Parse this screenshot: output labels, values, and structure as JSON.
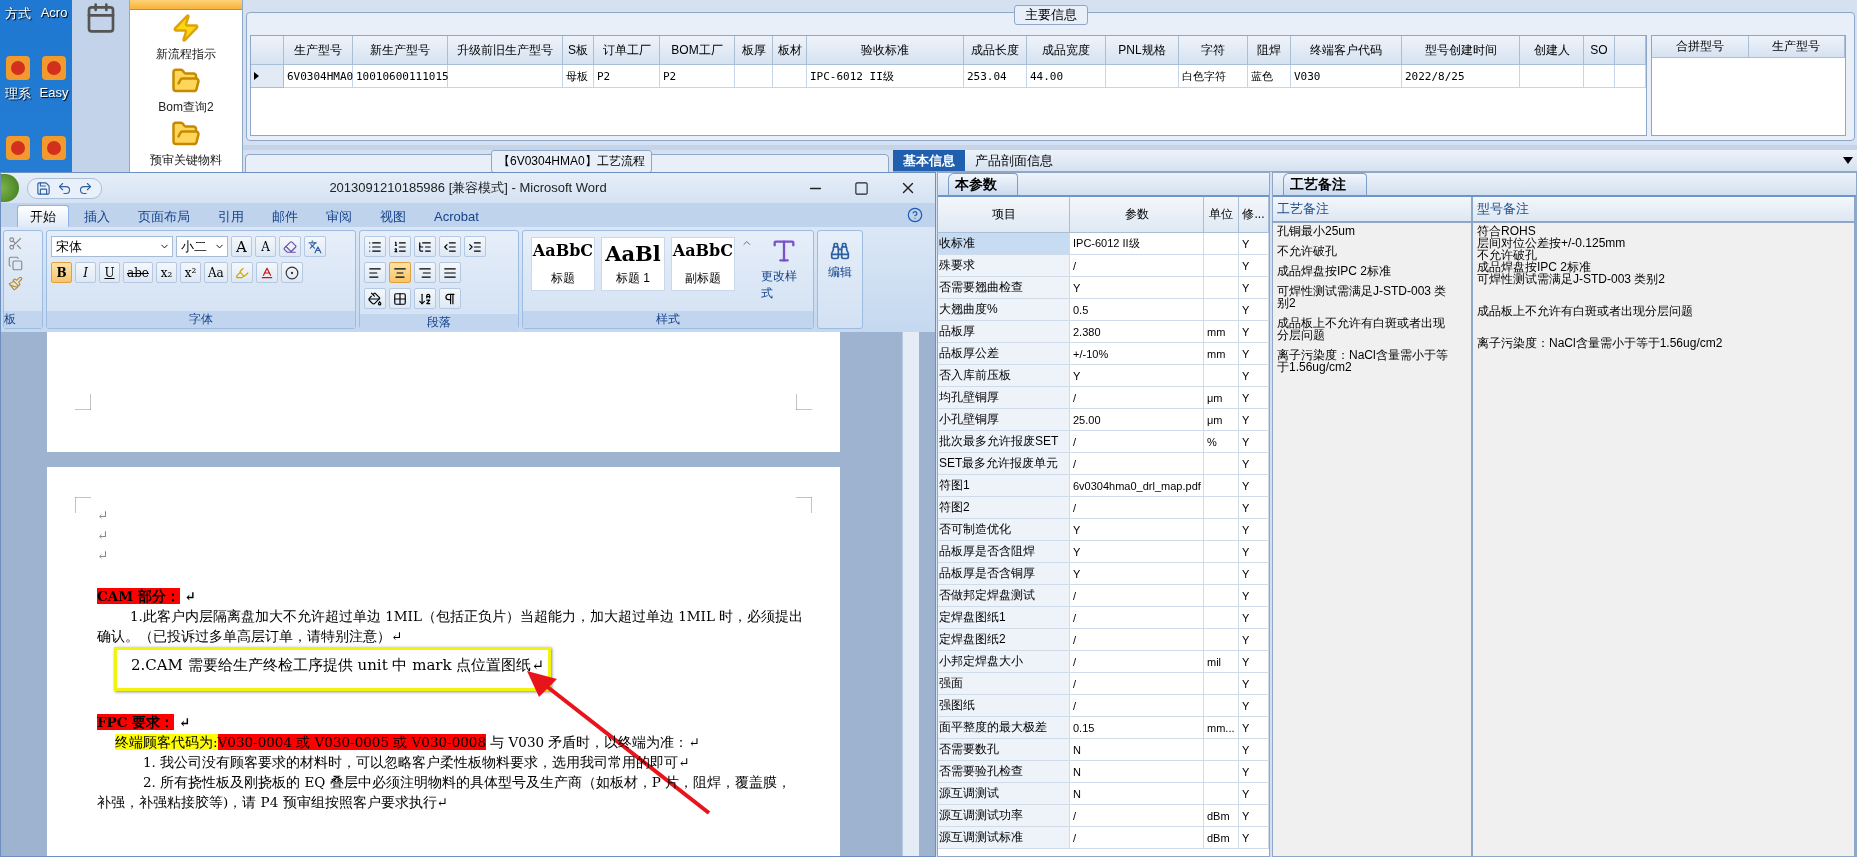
{
  "desktop_icons": [
    {
      "kind": "labeled",
      "label": "方式"
    },
    {
      "kind": "labeled",
      "label": "Acro"
    },
    {
      "kind": "labeled",
      "label": "理系"
    },
    {
      "kind": "labeled",
      "label": "Easy"
    },
    {
      "kind": "unlabeled"
    },
    {
      "kind": "unlabeled"
    }
  ],
  "sidebar": {
    "items": [
      {
        "kind": "process",
        "label": "新流程指示"
      },
      {
        "kind": "folder",
        "label": "Bom查询2"
      },
      {
        "kind": "folder",
        "label": "预审关键物料"
      }
    ]
  },
  "main_info": {
    "title": "主要信息",
    "columns": [
      "生产型号",
      "新生产型号",
      "升级前旧生产型号",
      "S板",
      "订单工厂",
      "BOM工厂",
      "板厚",
      "板材",
      "验收标准",
      "成品长度",
      "成品宽度",
      "PNL规格",
      "字符",
      "阻焊",
      "终端客户代码",
      "型号创建时间",
      "创建人",
      "SO"
    ],
    "rows": [
      {
        "selected": true,
        "cells": [
          "6V0304HMA0",
          "10010600111015",
          null,
          "母板",
          "P2",
          "P2",
          null,
          null,
          "IPC-6012 II级",
          "253.04",
          "44.00",
          null,
          "白色字符",
          "蓝色",
          "V030",
          "2022/8/25",
          null,
          null
        ]
      }
    ],
    "merge_columns": [
      "合拼型号",
      "生产型号"
    ]
  },
  "flow_panel": {
    "title": "【6V0304HMA0】工艺流程"
  },
  "detail_tabs": [
    {
      "label": "基本信息",
      "selected": true
    },
    {
      "label": "产品剖面信息",
      "selected": false
    }
  ],
  "params": {
    "tab": "本参数",
    "columns": [
      "项目",
      "参数",
      "单位",
      "修..."
    ],
    "rows": [
      {
        "item": "收标准",
        "value": "IPC-6012 II级",
        "flag": "Y",
        "selected": true
      },
      {
        "item": "殊要求",
        "value": "/",
        "flag": "Y",
        "selected": false
      },
      {
        "item": "否需要翘曲检查",
        "value": "Y",
        "flag": "Y",
        "selected": false
      },
      {
        "item": "大翘曲度%",
        "value": "0.5",
        "flag": "Y",
        "selected": false
      },
      {
        "item": "品板厚",
        "value": "2.380",
        "unit": "mm",
        "flag": "Y",
        "selected": false
      },
      {
        "item": "品板厚公差",
        "value": "+/-10%",
        "unit": "mm",
        "flag": "Y",
        "selected": false
      },
      {
        "item": "否入库前压板",
        "value": "Y",
        "flag": "Y",
        "selected": false
      },
      {
        "item": "均孔壁铜厚",
        "value": "/",
        "unit": "μm",
        "flag": "Y",
        "selected": false
      },
      {
        "item": "小孔壁铜厚",
        "value": "25.00",
        "unit": "μm",
        "flag": "Y",
        "selected": false
      },
      {
        "item": "批次最多允许报废SET",
        "value": "/",
        "unit": "%",
        "flag": "Y",
        "selected": false
      },
      {
        "item": "SET最多允许报废单元",
        "value": "/",
        "flag": "Y",
        "selected": false
      },
      {
        "item": "符图1",
        "value": "6v0304hma0_drl_map.pdf",
        "flag": "Y",
        "selected": false
      },
      {
        "item": "符图2",
        "value": "/",
        "flag": "Y",
        "selected": false
      },
      {
        "item": "否可制造优化",
        "value": "Y",
        "flag": "Y",
        "selected": false
      },
      {
        "item": "品板厚是否含阻焊",
        "value": "Y",
        "flag": "Y",
        "selected": false
      },
      {
        "item": "品板厚是否含铜厚",
        "value": "Y",
        "flag": "Y",
        "selected": false
      },
      {
        "item": "否做邦定焊盘测试",
        "value": "/",
        "flag": "Y",
        "selected": false
      },
      {
        "item": "定焊盘图纸1",
        "value": "/",
        "flag": "Y",
        "selected": false
      },
      {
        "item": "定焊盘图纸2",
        "value": "/",
        "flag": "Y",
        "selected": false
      },
      {
        "item": "小邦定焊盘大小",
        "value": "/",
        "unit": "mil",
        "flag": "Y",
        "selected": false
      },
      {
        "item": "强面",
        "value": "/",
        "flag": "Y",
        "selected": false
      },
      {
        "item": "强图纸",
        "value": "/",
        "flag": "Y",
        "selected": false
      },
      {
        "item": "面平整度的最大极差",
        "value": "0.15",
        "unit": "mm...",
        "flag": "Y",
        "selected": false
      },
      {
        "item": "否需要数孔",
        "value": "N",
        "flag": "Y",
        "selected": false
      },
      {
        "item": "否需要验孔检查",
        "value": "N",
        "flag": "Y",
        "selected": false
      },
      {
        "item": "源互调测试",
        "value": "N",
        "flag": "Y",
        "selected": false
      },
      {
        "item": "源互调测试功率",
        "value": "/",
        "unit": "dBm",
        "flag": "Y",
        "selected": false
      },
      {
        "item": "源互调测试标准",
        "value": "/",
        "unit": "dBm",
        "flag": "Y",
        "selected": false
      }
    ]
  },
  "notes": {
    "tab": "工艺备注",
    "columns": [
      "工艺备注",
      "型号备注"
    ],
    "process_notes": [
      "孔铜最小25um",
      "不允许破孔",
      "成品焊盘按IPC 2标准",
      "可焊性测试需满足J-STD-003 类别2",
      "成品板上不允许有白斑或者出现分层问题",
      "离子污染度：NaCl含量需小于等于1.56ug/cm2"
    ],
    "model_notes": [
      [
        "符合ROHS",
        "层间对位公差按+/-0.125mm",
        "不允许破孔",
        "成品焊盘按IPC 2标准",
        "可焊性测试需满足J-STD-003 类别2"
      ],
      [
        "成品板上不允许有白斑或者出现分层问题"
      ],
      [
        "离子污染度：NaCl含量需小于等于1.56ug/cm2"
      ]
    ]
  },
  "word": {
    "title": "2013091210185986 [兼容模式] - Microsoft Word",
    "tabs": [
      {
        "label": "开始",
        "selected": true
      },
      {
        "label": "插入",
        "selected": false
      },
      {
        "label": "页面布局",
        "selected": false
      },
      {
        "label": "引用",
        "selected": false
      },
      {
        "label": "邮件",
        "selected": false
      },
      {
        "label": "审阅",
        "selected": false
      },
      {
        "label": "视图",
        "selected": false
      },
      {
        "label": "Acrobat",
        "selected": false
      }
    ],
    "clipboard_group": "板",
    "font": {
      "name": "宋体",
      "size": "小二",
      "size_buttons": [
        "A",
        "A"
      ],
      "format_buttons": [
        {
          "label": "B",
          "selected": true
        },
        {
          "label": "I",
          "selected": false
        },
        {
          "label": "U",
          "selected": false
        },
        {
          "label": "abe",
          "selected": false
        },
        {
          "label": "x₂",
          "selected": false
        },
        {
          "label": "x²",
          "selected": false
        },
        {
          "label": "Aa",
          "selected": false
        }
      ],
      "group": "字体"
    },
    "paragraph": {
      "alignments": [
        {
          "selected": false
        },
        {
          "selected": true
        },
        {
          "selected": false
        },
        {
          "selected": false
        }
      ],
      "group": "段落"
    },
    "styles": [
      {
        "preview": "AaBbC",
        "label": "标题"
      },
      {
        "preview": "AaBl",
        "label": "标题 1"
      },
      {
        "preview": "AaBbC",
        "label": "副标题"
      }
    ],
    "change_styles": "更改样式",
    "styles_group": "样式",
    "editing": "编辑",
    "document": [
      {
        "kind": "blank",
        "segments": [
          {
            "text": "↵"
          }
        ]
      },
      {
        "kind": "blank",
        "segments": [
          {
            "text": "↵"
          }
        ]
      },
      {
        "kind": "blank",
        "segments": [
          {
            "text": "↵"
          }
        ]
      },
      {
        "kind": "heading",
        "segments": [
          {
            "text": "CAM 部分：",
            "color": "#ff0000"
          },
          {
            "text": " ↵"
          }
        ]
      },
      {
        "kind": "indent",
        "segments": [
          {
            "text": "1.此客户内层隔离盘加大不允许超过单边 1MIL（包括正负片）当超能力，加大超过单边 1MIL 时，必须提出"
          }
        ]
      },
      {
        "kind": "plain",
        "segments": [
          {
            "text": "确认。（已投诉过多单高层订单，请特别注意）↵"
          }
        ]
      },
      {
        "kind": "boxed",
        "segments": [
          {
            "text": "2.CAM 需要给生产终检工序提供 unit 中 mark 点位置图纸↵"
          }
        ]
      },
      {
        "kind": "heading",
        "segments": [
          {
            "text": "FPC 要求：",
            "color": "#ff0000"
          },
          {
            "text": " ↵"
          }
        ]
      },
      {
        "kind": "lead",
        "segments": [
          {
            "text": "终端顾客代码为:",
            "color": "#ffff00"
          },
          {
            "text": "V030-0004 或 V030-0005 或 V030-0008",
            "color": "#ff0000"
          },
          {
            "text": " 与 V030 矛盾时，以终端为准：↵"
          }
        ]
      },
      {
        "kind": "deep",
        "segments": [
          {
            "text": "1.  我公司没有顾客要求的材料时，可以忽略客户柔性板物料要求，选用我司常用的即可↵"
          }
        ]
      },
      {
        "kind": "deep",
        "segments": [
          {
            "text": "2.  所有挠性板及刚挠板的 EQ 叠层中必须注明物料的具体型号及生产商（如板材，P 片，阻焊，覆盖膜，"
          }
        ]
      },
      {
        "kind": "plain",
        "segments": [
          {
            "text": "补强，补强粘接胶等)，请 P4 预审组按照客户要求执行↵"
          }
        ]
      }
    ]
  }
}
